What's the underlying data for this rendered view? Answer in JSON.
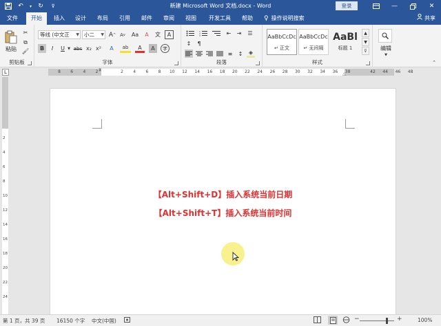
{
  "titlebar": {
    "title": "新建 Microsoft Word 文档.docx  -  Word",
    "login_label": "登录",
    "icons": [
      "save-icon",
      "undo-icon",
      "redo-icon",
      "customize-qat-icon",
      "ribbon-display-icon",
      "minimize-icon",
      "restore-icon",
      "close-icon"
    ]
  },
  "tabs": {
    "file": "文件",
    "home": "开始",
    "insert": "插入",
    "design": "设计",
    "layout": "布局",
    "references": "引用",
    "mailings": "邮件",
    "review": "审阅",
    "view": "视图",
    "developer": "开发工具",
    "help": "帮助",
    "tell_me": "操作说明搜索",
    "share": "共享"
  },
  "ribbon": {
    "clipboard": {
      "label": "剪贴板",
      "paste": "粘贴"
    },
    "font": {
      "label": "字体",
      "font_name": "等线 (中文正",
      "font_size": "小二",
      "grow": "A",
      "shrink": "A",
      "case": "Aa",
      "clear": "A",
      "wen": "文",
      "bold": "B",
      "italic": "I",
      "underline": "U",
      "strike": "abc",
      "subscript": "x₂",
      "superscript": "x²",
      "text_effects": "A",
      "highlight": "ab",
      "font_color": "A",
      "char_shading": "A",
      "enclose": "字"
    },
    "paragraph": {
      "label": "段落"
    },
    "styles": {
      "label": "样式",
      "items": [
        {
          "sample": "AaBbCcDc",
          "name": "↵ 正文"
        },
        {
          "sample": "AaBbCcDc",
          "name": "↵ 无间隔"
        },
        {
          "sample": "AaBl",
          "name": "标题 1"
        }
      ]
    },
    "editing": {
      "label": "编辑"
    }
  },
  "ruler": {
    "tab_selector": "L",
    "numbers": [
      "8",
      "6",
      "4",
      "2",
      "",
      "2",
      "4",
      "6",
      "8",
      "10",
      "12",
      "14",
      "16",
      "18",
      "20",
      "22",
      "24",
      "26",
      "28",
      "30",
      "32",
      "34",
      "36",
      "38",
      "",
      "42",
      "44",
      "46",
      "48"
    ]
  },
  "vruler": {
    "numbers": [
      "2",
      "4",
      "6",
      "8",
      "10",
      "12",
      "14",
      "16",
      "18",
      "20",
      "22",
      "24"
    ]
  },
  "document": {
    "lines": [
      "【Alt+Shift+D】插入系统当前日期",
      "【Alt+Shift+T】插入系统当前时间"
    ]
  },
  "statusbar": {
    "page": "第 1 页，共 39 页",
    "words": "16150 个字",
    "language": "中文(中国)",
    "zoom": "100%",
    "zoom_minus": "−",
    "zoom_plus": "+"
  },
  "colors": {
    "accent": "#2b579a",
    "doc_text": "#e03131",
    "cursor_highlight": "#f7ef7a"
  }
}
